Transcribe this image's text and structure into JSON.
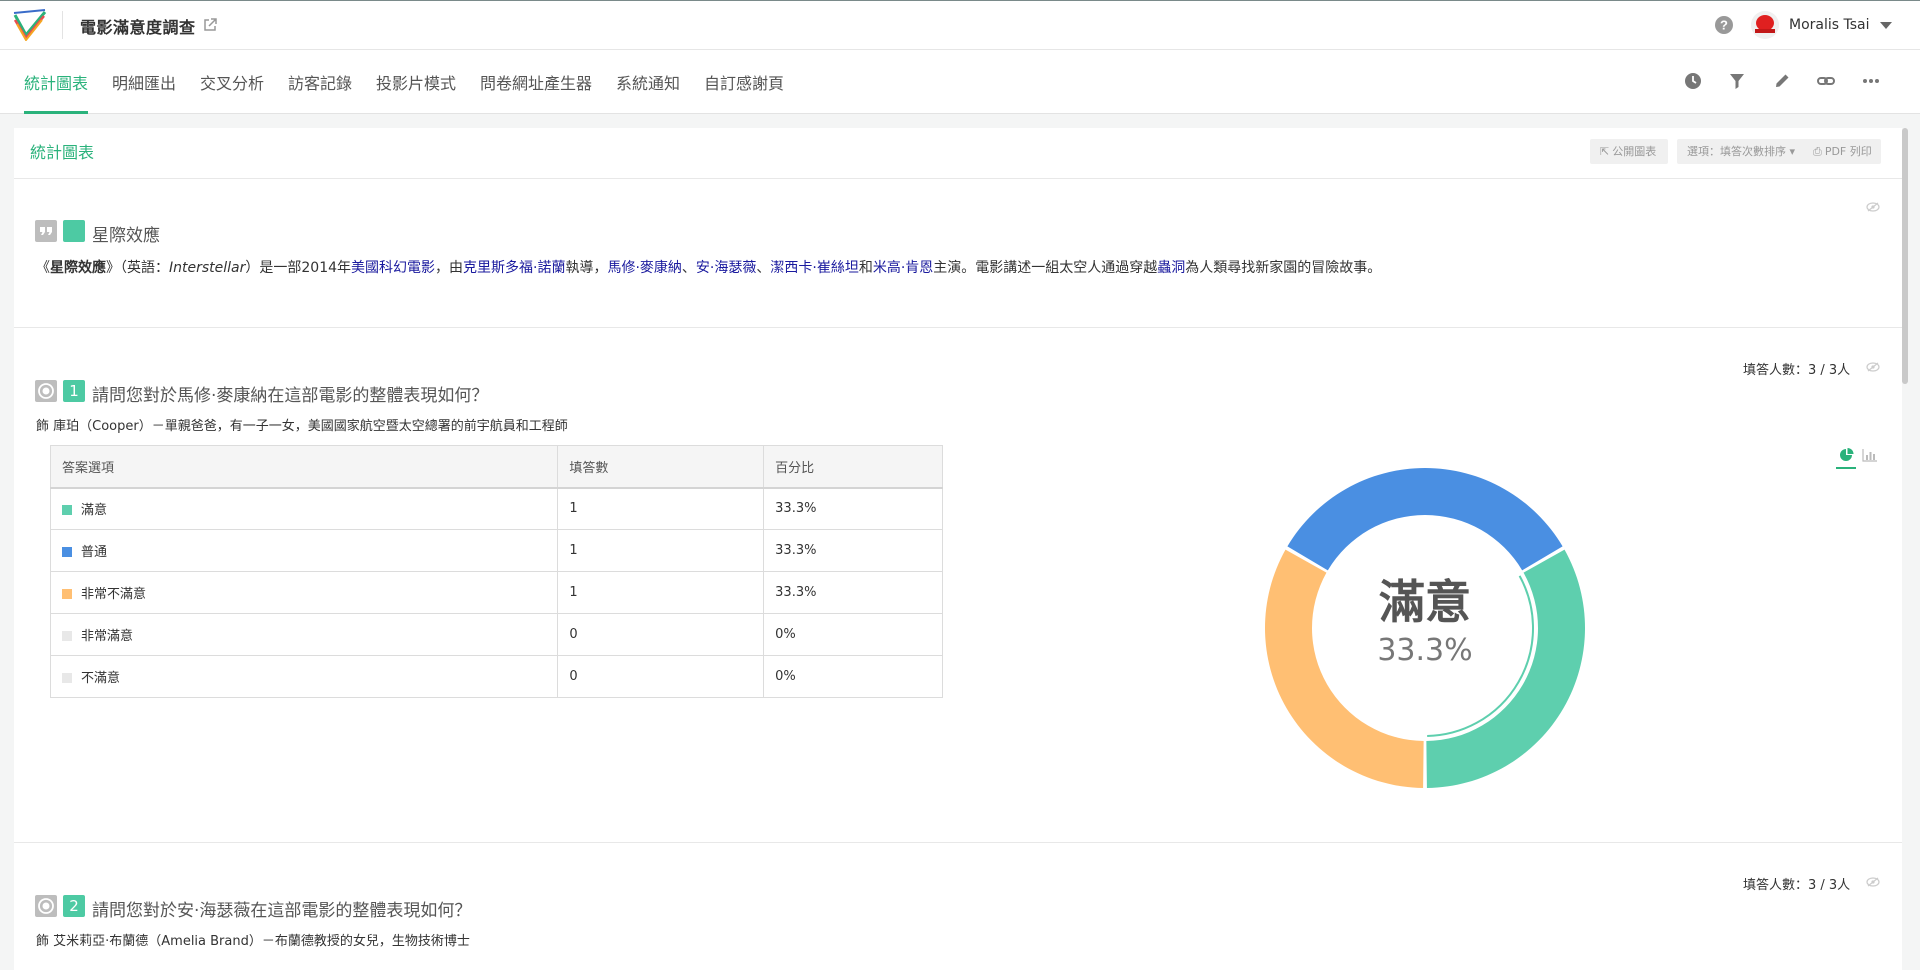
{
  "header": {
    "survey_title": "電影滿意度調查",
    "user_name": "Moralis Tsai"
  },
  "nav": {
    "tabs": [
      "統計圖表",
      "明細匯出",
      "交叉分析",
      "訪客記錄",
      "投影片模式",
      "問卷網址產生器",
      "系統通知",
      "自訂感謝頁"
    ],
    "active_tab": "統計圖表",
    "right_icons": [
      "history-icon",
      "filter-icon",
      "edit-icon",
      "link-icon",
      "more-icon"
    ]
  },
  "section": {
    "title": "統計圖表",
    "buttons": {
      "public_chart": "公開圖表",
      "sort_option": "選項：填答次數排序",
      "pdf_print": "PDF 列印"
    }
  },
  "intro": {
    "title": "星際效應",
    "text": {
      "p1": "《",
      "title_bold": "星際效應",
      "p2": "》（英語：",
      "english_italic": "Interstellar",
      "p3": "）是一部2014年",
      "link1": "美國科幻電影",
      "p4": "，由",
      "link2": "克里斯多福·諾蘭",
      "p5": "執導，",
      "link3": "馬修·麥康納",
      "p6": "、",
      "link4": "安·海瑟薇",
      "p7": "、",
      "link5": "潔西卡·崔絲坦",
      "p8": "和",
      "link6": "米高·肯恩",
      "p9": "主演。電影講述一組太空人通過穿越",
      "link7": "蟲洞",
      "p10": "為人類尋找新家園的冒險故事。"
    }
  },
  "questions": [
    {
      "number": "1",
      "title": "請問您對於馬修·麥康納在這部電影的整體表現如何？",
      "description": "飾 庫珀（Cooper）－單親爸爸，有一子一女，美國國家航空暨太空總署的前宇航員和工程師",
      "response_count": "填答人數：3 / 3人",
      "table": {
        "headers": [
          "答案選項",
          "填答數",
          "百分比"
        ],
        "rows": [
          {
            "label": "滿意",
            "count": "1",
            "percent": "33.3%",
            "color": "#5ecfae"
          },
          {
            "label": "普通",
            "count": "1",
            "percent": "33.3%",
            "color": "#4a8fe2"
          },
          {
            "label": "非常不滿意",
            "count": "1",
            "percent": "33.3%",
            "color": "#ffbf73"
          },
          {
            "label": "非常滿意",
            "count": "0",
            "percent": "0%",
            "color": "#e8e8e8"
          },
          {
            "label": "不滿意",
            "count": "0",
            "percent": "0%",
            "color": "#e8e8e8"
          }
        ]
      },
      "donut_center": {
        "label": "滿意",
        "value": "33.3%"
      }
    },
    {
      "number": "2",
      "title": "請問您對於安·海瑟薇在這部電影的整體表現如何？",
      "description": "飾 艾米莉亞·布蘭德（Amelia Brand）－布蘭德教授的女兒，生物技術博士",
      "response_count": "填答人數：3 / 3人"
    }
  ],
  "chart_data": {
    "type": "pie",
    "donut": true,
    "categories": [
      "滿意",
      "普通",
      "非常不滿意",
      "非常滿意",
      "不滿意"
    ],
    "values": [
      1,
      1,
      1,
      0,
      0
    ],
    "percentages": [
      33.3,
      33.3,
      33.3,
      0,
      0
    ],
    "colors": [
      "#5ecfae",
      "#4a8fe2",
      "#ffbf73",
      "#e8e8e8",
      "#e8e8e8"
    ],
    "highlighted": "滿意"
  }
}
